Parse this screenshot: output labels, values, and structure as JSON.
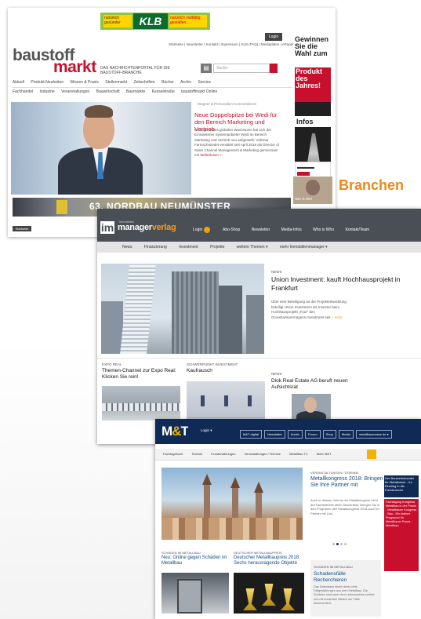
{
  "side_label": "Branchen",
  "screen1": {
    "top_ad": {
      "left": "natürlich gesünder",
      "brand": "KLB",
      "right": "natürlich vielfältig gestalten"
    },
    "logo_top": "baustoff",
    "logo_bottom": "markt",
    "tagline": "DAS NACHRICHTENPORTAL FÜR DIE BAUSTOFF-BRANCHE",
    "top_links": "Startseite | Newsletter | Kontakt | Impressum | KLB (FAQ) | Mediadaten | ePaper",
    "login": "Login",
    "search_placeholder": "Suche",
    "nav_main": [
      "Aktuell",
      "Produkt-Neuheiten",
      "Wissen & Praxis",
      "Stellenmarkt",
      "Zeitschriften",
      "Bücher",
      "Archiv",
      "Service"
    ],
    "nav_sub": [
      "Fachhandel",
      "Industrie",
      "Veranstaltungen",
      "Bauwirtschaft",
      "Baumärkte",
      "Kesselstraße",
      "baustoffmarkt Online"
    ],
    "article_meta": "Wagner & Personalien   Kommentieren",
    "headline": "Neue Doppelspitze bei Wedi für den Bereich Marketing und Vertrieb",
    "teaser": "Im Zuge seines globalen Wachstums hat sich der Emsdettener Systemanbieter Wedi im Bereich Marketing und Vertrieb neu aufgestellt: Volkmar Farmschmiedet verstärkt seit April 2018 als Director of Sales Channel Management & Marketing gemeinsam mit",
    "more": "Weiterlesen »",
    "right_ad_text": "Gewinnen Sie die Wahl zum",
    "right_ad_red": "Produkt des Jahres!",
    "right_ad_infos": "Infos",
    "right_who": "Wer is Wer",
    "banner_text": "63. NORDBAU NEUMÜNSTER",
    "footer_badge": "Startseite"
  },
  "screen2": {
    "logo_main": "immobilien",
    "logo_sub": "manager",
    "logo_sub2": "verlag",
    "login": "Login",
    "login_count": "0",
    "top_nav": [
      "Abo-Shop",
      "Newsletter",
      "Media-Infos",
      "Who is Who",
      "Kontakt/Team"
    ],
    "nav": [
      "News",
      "Finanzierung",
      "Investment",
      "Projekte",
      "weitere Themen ▾",
      "mehr Immobilienmanager ▾"
    ],
    "news_label": "NEWS",
    "headline": "Union Investment: kauft Hochhausprojekt in Frankfurt",
    "teaser": "Über eine Beteiligung an der Projektentwicklung beteiligt Union Investment als Investor beim Hochhausprojekt „Four“ des Grossbankvermögens Investment seit",
    "more": "» mehr",
    "card1_cat": "EXPO REAL",
    "card1_head": "Themen-Channel zur Expo Real: Klicken Sie rein!",
    "card2_cat": "SCHWERPUNKT INVESTMENT",
    "card2_head": "Kaufrausch",
    "card3_cat": "NEWS",
    "card3_head": "Diok Real Estate AG beruft neuen Aufsichtsrat"
  },
  "screen3": {
    "logo_m": "M",
    "logo_amp": "&",
    "logo_t": "T",
    "login": "Login ▾",
    "header_buttons": [
      "M&T digital",
      "Newsletter",
      "Archiv",
      "Forum",
      "Shop",
      "Media",
      "metallbaumesse.de ▾"
    ],
    "nav": [
      "Fachtagebuch",
      "Technik",
      "Fensterwiklungen",
      "Veranstaltungen / Termine",
      "Metallbau TV",
      "Mehr M&T"
    ],
    "right_cat": "VERANSTALTUNGEN / TERMINE",
    "right_head": "Metallkongress 2018: Bringen Sie Ihre Partner mit",
    "right_teaser": "Auch in diesem Jahr ist der Metallkongress nicht auf Fachbetriebe allein beschränkt. Bringen Sie in den Programm den Metallkongress 2018 auch Ihr Partner mit Link.",
    "side_blue": "Der Bauwerkshandel für Metallbauer - Ihr Einstieg in die Fachbranche",
    "side_red": "Fachtagung Kongress Metallbau in der Praxis - Metallbauer Kongress - Bau - Ein starkes Programm für Metallbauer Praxis - Metallbau",
    "b1_cat": "SCHÄDEN IM METALLBAU",
    "b1_head": "Neu: Online gegen Schäden im Metallbau",
    "b2_cat": "DEUTSCHER METALLBAUPREIS",
    "b2_head": "Deutscher Metallbaupreis 2018: Sechs herausragende Objekte",
    "b3_cat": "SCHÄDEN IM METALLBAU",
    "b3_head": "Schadensfälle Recherchieren",
    "b3_teaser": "Das Datenbank bietet direkt viele Fallgestaltungen aus dem Metallbau. Die Schäden sind nach dem Lebenszyklus sortiert und mit konkreten Bildern der Fälle dokumentiert."
  }
}
